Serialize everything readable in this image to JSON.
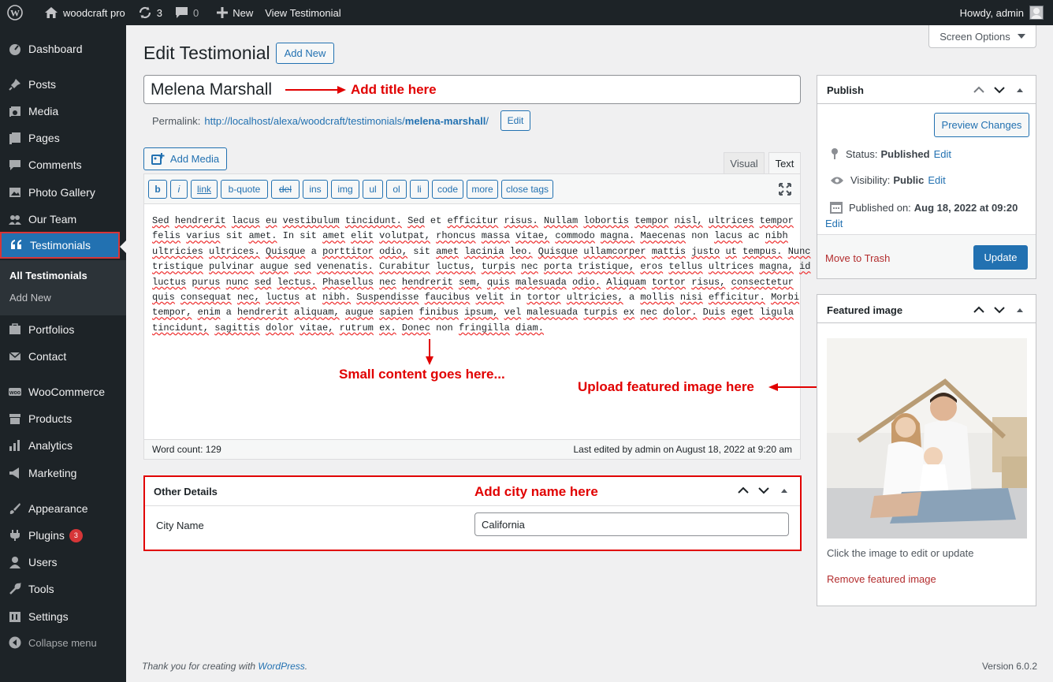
{
  "admin_bar": {
    "site_name": "woodcraft pro",
    "updates_count": "3",
    "comments_count": "0",
    "new_label": "New",
    "view_label": "View Testimonial",
    "howdy": "Howdy, admin"
  },
  "sidebar": {
    "items": [
      {
        "label": "Dashboard",
        "icon": "dashboard-icon"
      },
      {
        "label": "Posts",
        "icon": "pin-icon"
      },
      {
        "label": "Media",
        "icon": "media-icon"
      },
      {
        "label": "Pages",
        "icon": "pages-icon"
      },
      {
        "label": "Comments",
        "icon": "comments-icon"
      },
      {
        "label": "Photo Gallery",
        "icon": "gallery-icon"
      },
      {
        "label": "Our Team",
        "icon": "team-icon"
      },
      {
        "label": "Testimonials",
        "icon": "quote-icon"
      },
      {
        "label": "Portfolios",
        "icon": "portfolio-icon"
      },
      {
        "label": "Contact",
        "icon": "mail-icon"
      },
      {
        "label": "WooCommerce",
        "icon": "woo-icon"
      },
      {
        "label": "Products",
        "icon": "products-icon"
      },
      {
        "label": "Analytics",
        "icon": "analytics-icon"
      },
      {
        "label": "Marketing",
        "icon": "marketing-icon"
      },
      {
        "label": "Appearance",
        "icon": "appearance-icon"
      },
      {
        "label": "Plugins",
        "icon": "plugins-icon",
        "badge": "3"
      },
      {
        "label": "Users",
        "icon": "users-icon"
      },
      {
        "label": "Tools",
        "icon": "tools-icon"
      },
      {
        "label": "Settings",
        "icon": "settings-icon"
      }
    ],
    "submenu": [
      "All Testimonials",
      "Add New"
    ],
    "collapse_label": "Collapse menu"
  },
  "header": {
    "title": "Edit Testimonial",
    "add_new": "Add New",
    "screen_options": "Screen Options"
  },
  "post": {
    "title": "Melena Marshall",
    "permalink_label": "Permalink:",
    "permalink_base": "http://localhost/alexa/woodcraft/testimonials/",
    "permalink_slug": "melena-marshall",
    "permalink_end": "/",
    "edit_label": "Edit"
  },
  "editor": {
    "add_media": "Add Media",
    "tab_visual": "Visual",
    "tab_text": "Text",
    "quicktags": [
      "b",
      "i",
      "link",
      "b-quote",
      "del",
      "ins",
      "img",
      "ul",
      "ol",
      "li",
      "code",
      "more",
      "close tags"
    ],
    "content_lines": [
      "Sed hendrerit lacus eu vestibulum tincidunt. Sed et efficitur risus. Nullam lobortis tempor nisl, ultrices tempor",
      "felis varius sit amet. In sit amet elit volutpat, rhoncus massa vitae, commodo magna. Maecenas non lacus ac nibh",
      "ultricies ultrices. Quisque a porttitor odio, sit amet lacinia leo. Quisque ullamcorper mattis justo ut tempus. Nunc",
      "tristique pulvinar augue sed venenatis. Curabitur luctus, turpis nec porta tristique, eros tellus ultrices magna, id",
      "luctus purus nunc sed lectus. Phasellus nec hendrerit sem, quis malesuada odio. Aliquam tortor risus, consectetur",
      "quis consequat nec, luctus at nibh. Suspendisse faucibus velit in tortor ultricies, a mollis nisi efficitur. Morbi",
      "tempor, enim a hendrerit aliquam, augue sapien finibus ipsum, vel malesuada turpis ex nec dolor. Duis eget ligula",
      "tincidunt, sagittis dolor vitae, rutrum ex. Donec non fringilla diam."
    ],
    "word_count": "Word count: 129",
    "last_edited": "Last edited by admin on August 18, 2022 at 9:20 am"
  },
  "annotations": {
    "title": "Add title here",
    "content": "Small content goes here...",
    "featured": "Upload featured image here",
    "city": "Add city name here",
    "color": "#e10000"
  },
  "other_details": {
    "title": "Other Details",
    "city_label": "City Name",
    "city_value": "California"
  },
  "publish": {
    "title": "Publish",
    "preview": "Preview Changes",
    "status_label": "Status:",
    "status_value": "Published",
    "visibility_label": "Visibility:",
    "visibility_value": "Public",
    "published_label": "Published on:",
    "published_value": "Aug 18, 2022 at 09:20",
    "edit": "Edit",
    "trash": "Move to Trash",
    "update": "Update"
  },
  "featured_image": {
    "title": "Featured image",
    "hint": "Click the image to edit or update",
    "remove": "Remove featured image"
  },
  "footer": {
    "thanks_prefix": "Thank you for creating with ",
    "wp_link": "WordPress",
    "thanks_suffix": ".",
    "version": "Version 6.0.2"
  },
  "colors": {
    "admin_bg": "#1d2327",
    "accent": "#2271b1",
    "annotation": "#e10000",
    "body_bg": "#f0f0f1"
  }
}
